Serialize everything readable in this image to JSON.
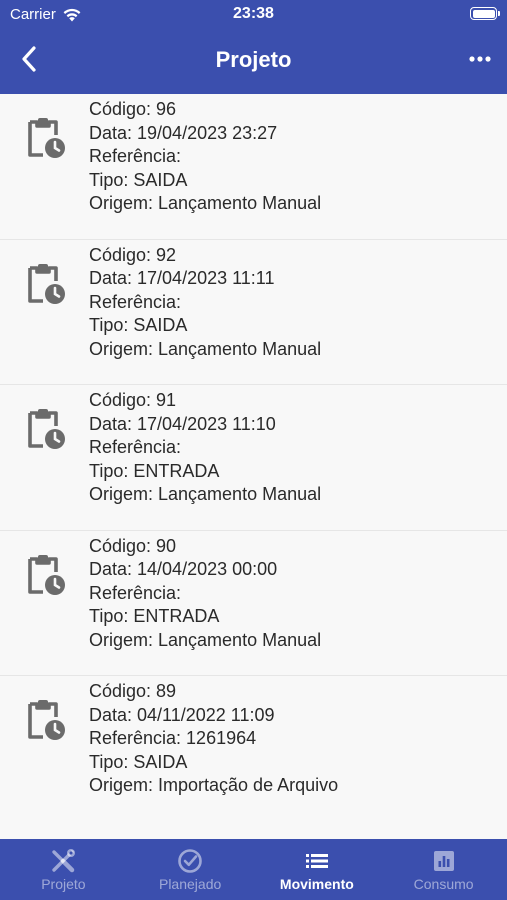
{
  "status_bar": {
    "carrier": "Carrier",
    "time": "23:38"
  },
  "header": {
    "title": "Projeto"
  },
  "movements": [
    {
      "codigo": "Código: 96",
      "data": "Data: 19/04/2023 23:27",
      "referencia": "Referência:",
      "tipo": "Tipo: SAIDA",
      "origem": "Origem: Lançamento Manual"
    },
    {
      "codigo": "Código: 92",
      "data": "Data: 17/04/2023 11:11",
      "referencia": "Referência:",
      "tipo": "Tipo: SAIDA",
      "origem": "Origem: Lançamento Manual"
    },
    {
      "codigo": "Código: 91",
      "data": "Data: 17/04/2023 11:10",
      "referencia": "Referência:",
      "tipo": "Tipo: ENTRADA",
      "origem": "Origem: Lançamento Manual"
    },
    {
      "codigo": "Código: 90",
      "data": "Data: 14/04/2023 00:00",
      "referencia": "Referência:",
      "tipo": "Tipo: ENTRADA",
      "origem": "Origem: Lançamento Manual"
    },
    {
      "codigo": "Código: 89",
      "data": "Data: 04/11/2022 11:09",
      "referencia": "Referência: 1261964",
      "tipo": "Tipo: SAIDA",
      "origem": "Origem: Importação de Arquivo"
    }
  ],
  "tabs": [
    {
      "label": "Projeto",
      "icon": "tools-icon",
      "active": false
    },
    {
      "label": "Planejado",
      "icon": "check-circle-icon",
      "active": false
    },
    {
      "label": "Movimento",
      "icon": "list-icon",
      "active": true
    },
    {
      "label": "Consumo",
      "icon": "bar-chart-icon",
      "active": false
    }
  ],
  "colors": {
    "primary": "#3b4fae",
    "background": "#f8f8f8",
    "text": "#2a2a2a",
    "icon": "#6b6b6b"
  }
}
